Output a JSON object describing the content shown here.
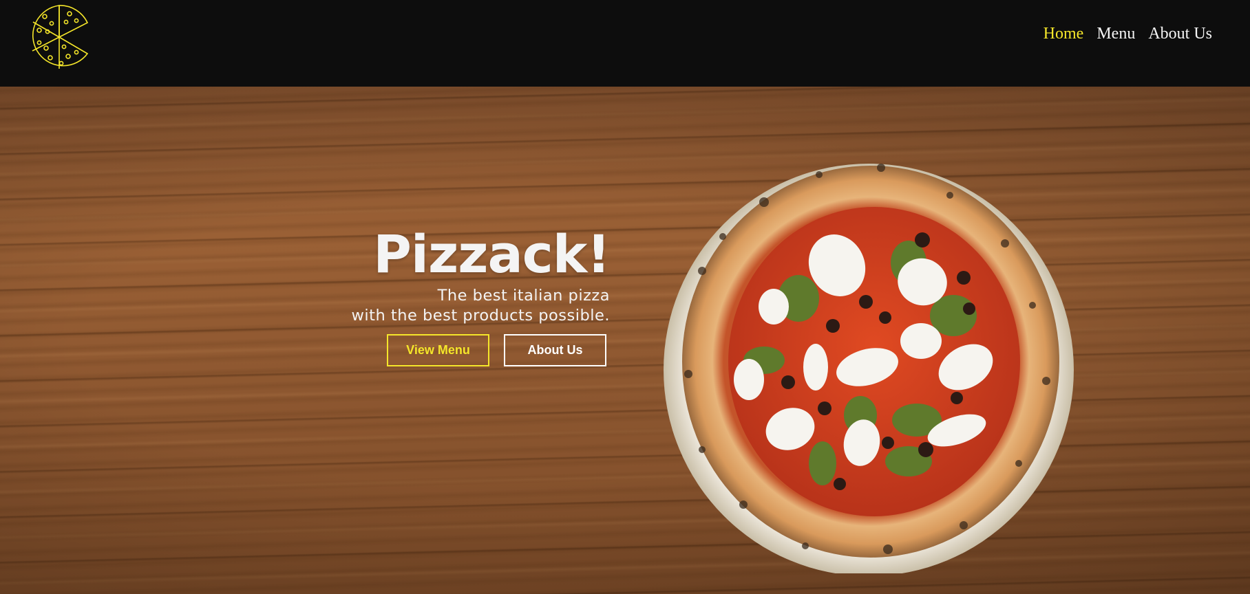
{
  "brand": {
    "logo": "pizza-logo-icon",
    "accent_color": "#f5e62a"
  },
  "nav": {
    "items": [
      {
        "label": "Home",
        "active": true
      },
      {
        "label": "Menu",
        "active": false
      },
      {
        "label": "About Us",
        "active": false
      }
    ]
  },
  "hero": {
    "title": "Pizzack!",
    "tagline_line1": "The best italian pizza",
    "tagline_line2": "with the best products possible.",
    "buttons": {
      "view_menu": "View Menu",
      "about_us": "About Us"
    },
    "image": "pizza-on-plate"
  }
}
